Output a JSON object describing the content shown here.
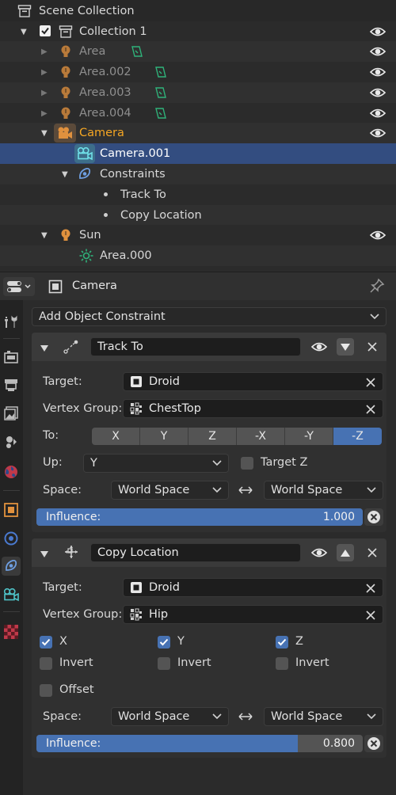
{
  "outliner": {
    "rows": [
      {
        "label": "Scene Collection"
      },
      {
        "label": "Collection 1"
      },
      {
        "label": "Area"
      },
      {
        "label": "Area.002"
      },
      {
        "label": "Area.003"
      },
      {
        "label": "Area.004"
      },
      {
        "label": "Camera"
      },
      {
        "label": "Camera.001"
      },
      {
        "label": "Constraints"
      },
      {
        "label": "Track To"
      },
      {
        "label": "Copy Location"
      },
      {
        "label": "Sun"
      },
      {
        "label": "Area.000"
      }
    ]
  },
  "header": {
    "context_label": "Camera"
  },
  "add_constraint": {
    "label": "Add Object Constraint"
  },
  "track_to": {
    "name": "Track To",
    "target_label": "Target:",
    "target_value": "Droid",
    "vgroup_label": "Vertex Group:",
    "vgroup_value": "ChestTop",
    "to_label": "To:",
    "axes": [
      "X",
      "Y",
      "Z",
      "-X",
      "-Y",
      "-Z"
    ],
    "axis_selected": "-Z",
    "up_label": "Up:",
    "up_value": "Y",
    "target_z_label": "Target Z",
    "target_z_checked": false,
    "space_label": "Space:",
    "space_owner": "World Space",
    "space_target": "World Space",
    "influence_label": "Influence:",
    "influence_value": "1.000",
    "influence": 1.0
  },
  "copy_location": {
    "name": "Copy Location",
    "target_label": "Target:",
    "target_value": "Droid",
    "vgroup_label": "Vertex Group:",
    "vgroup_value": "Hip",
    "axis_x": "X",
    "axis_y": "Y",
    "axis_z": "Z",
    "invert_label": "Invert",
    "offset_label": "Offset",
    "space_label": "Space:",
    "space_owner": "World Space",
    "space_target": "World Space",
    "influence_label": "Influence:",
    "influence_value": "0.800",
    "influence": 0.8
  },
  "colors": {
    "accent": "#4772b3",
    "selected_row": "#334d80",
    "camera_label": "#f5a623",
    "icon_orange": "#c8823c",
    "icon_teal": "#4fc3c8",
    "icon_green": "#2fb37a"
  },
  "icons": [
    "collection-icon",
    "checkbox-icon",
    "light-icon",
    "light-data-icon",
    "camera-icon",
    "camera-data-icon",
    "constraint-icon",
    "eye-icon",
    "sun-data-icon",
    "pin-icon",
    "close-icon",
    "chevron-down-icon",
    "move-down-icon",
    "move-up-icon",
    "track-to-icon",
    "copy-location-icon",
    "vertex-group-icon",
    "object-icon"
  ]
}
